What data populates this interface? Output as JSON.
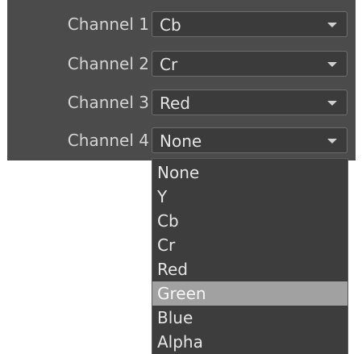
{
  "channels": [
    {
      "label": "Channel 1",
      "value": "Cb"
    },
    {
      "label": "Channel 2",
      "value": "Cr"
    },
    {
      "label": "Channel 3",
      "value": "Red"
    },
    {
      "label": "Channel 4",
      "value": "None"
    }
  ],
  "dropdown": {
    "options": [
      "None",
      "Y",
      "Cb",
      "Cr",
      "Red",
      "Green",
      "Blue",
      "Alpha"
    ],
    "highlighted": "Green"
  },
  "colors": {
    "panel_bg": "#4b4b4b",
    "combo_bg": "#3b3b3b",
    "highlight": "#a1a1a1"
  }
}
